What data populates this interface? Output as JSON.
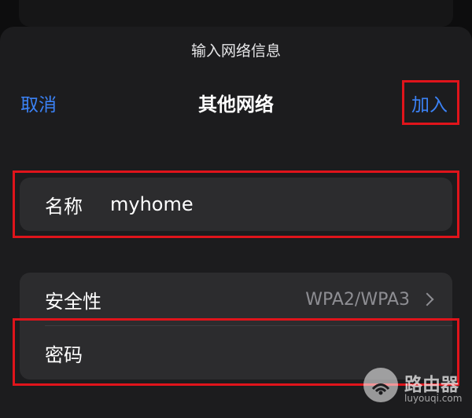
{
  "header": {
    "prompt": "输入网络信息",
    "cancel_label": "取消",
    "title": "其他网络",
    "join_label": "加入"
  },
  "name_row": {
    "label": "名称",
    "value": "myhome"
  },
  "security_row": {
    "label": "安全性",
    "value": "WPA2/WPA3"
  },
  "password_row": {
    "label": "密码",
    "value": ""
  },
  "watermark": {
    "title": "路由器",
    "subtitle": "luyouqi.com"
  },
  "colors": {
    "accent": "#3b82f6",
    "highlight": "#e0141b",
    "sheet": "#1c1c1e",
    "cell": "#2c2c2e"
  }
}
